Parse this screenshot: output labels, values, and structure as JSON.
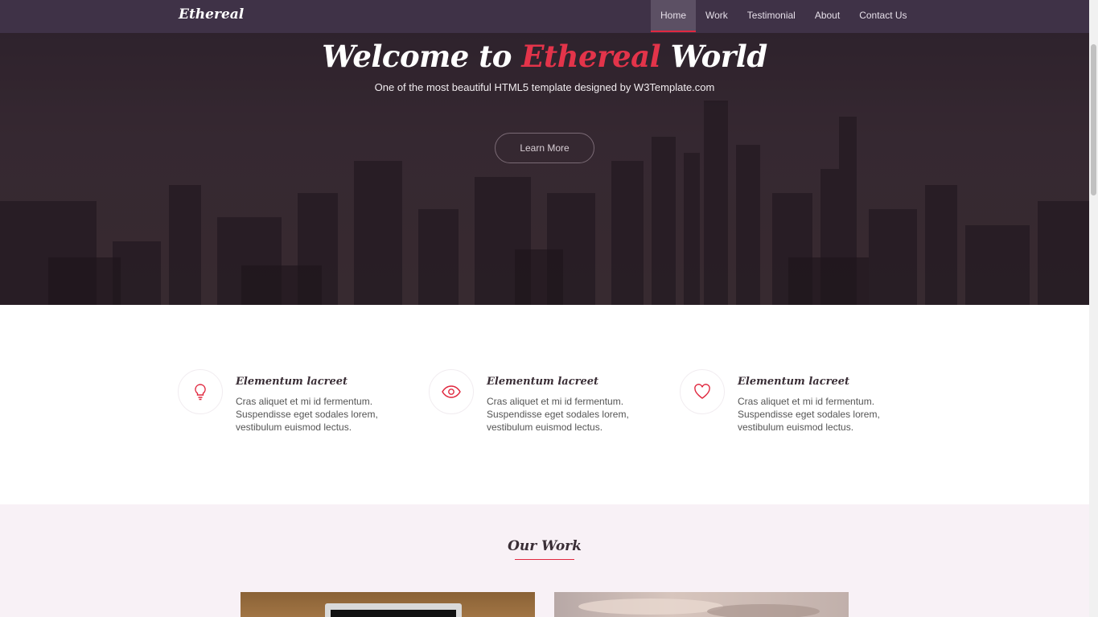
{
  "nav": {
    "brand": "Ethereal",
    "links": [
      {
        "label": "Home",
        "active": true
      },
      {
        "label": "Work"
      },
      {
        "label": "Testimonial"
      },
      {
        "label": "About"
      },
      {
        "label": "Contact Us"
      }
    ]
  },
  "hero": {
    "title_pre": "Welcome to",
    "title_accent": "Ethereal",
    "title_post": "World",
    "subtitle": "One of the most beautiful HTML5 template designed by W3Template.com",
    "button": "Learn More"
  },
  "features": [
    {
      "icon": "lightbulb-icon",
      "title": "Elementum lacreet",
      "text": "Cras aliquet et mi id fermentum. Suspendisse eget sodales lorem, vestibulum euismod lectus."
    },
    {
      "icon": "eye-icon",
      "title": "Elementum lacreet",
      "text": "Cras aliquet et mi id fermentum. Suspendisse eget sodales lorem, vestibulum euismod lectus."
    },
    {
      "icon": "heart-icon",
      "title": "Elementum lacreet",
      "text": "Cras aliquet et mi id fermentum. Suspendisse eget sodales lorem, vestibulum euismod lectus."
    }
  ],
  "work": {
    "title": "Our Work"
  },
  "colors": {
    "accent": "#e0283f",
    "nav_bg": "#3f3247",
    "work_bg": "#f8f1f6"
  }
}
